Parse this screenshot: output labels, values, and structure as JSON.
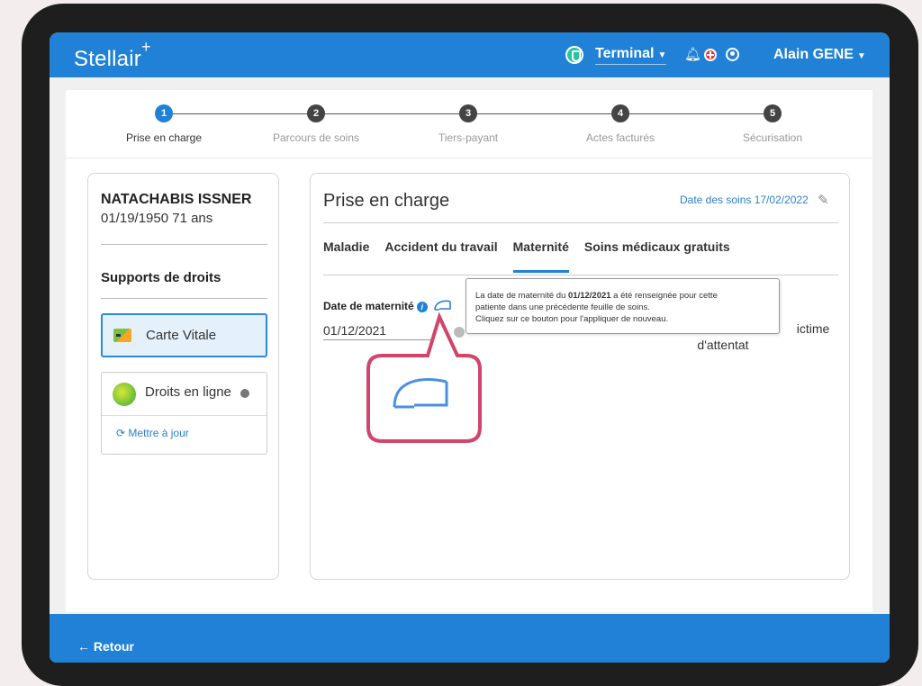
{
  "app": {
    "logo": "Stellair",
    "logo_mark": "+"
  },
  "header": {
    "terminal": "Terminal",
    "user": "Alain GENE"
  },
  "steps": [
    {
      "n": "1",
      "label": "Prise en charge"
    },
    {
      "n": "2",
      "label": "Parcours de soins"
    },
    {
      "n": "3",
      "label": "Tiers-payant"
    },
    {
      "n": "4",
      "label": "Actes facturés"
    },
    {
      "n": "5",
      "label": "Sécurisation"
    }
  ],
  "patient": {
    "name": "NATACHABIS ISSNER",
    "dob": "01/19/1950 71 ans"
  },
  "supports": {
    "title": "Supports de droits",
    "vitale": "Carte Vitale",
    "droits": "Droits en ligne",
    "adri_logo": "ADRi",
    "refresh": "Mettre à jour"
  },
  "main": {
    "title": "Prise en charge",
    "date_soins": "Date des soins 17/02/2022",
    "tabs": [
      "Maladie",
      "Accident du travail",
      "Maternité",
      "Soins médicaux gratuits"
    ],
    "date_maternite_label": "Date de maternité",
    "date_maternite_value": "01/12/2021",
    "victime_line1": "ictime",
    "victime_line2": "d'attentat"
  },
  "tooltip": {
    "pre": "La date de maternité du ",
    "bold": "01/12/2021",
    "post": " a été renseignée pour cette",
    "line2": "patiente dans une précédente feuille de soins.",
    "line3": "Cliquez sur ce bouton pour l'appliquer de nouveau."
  },
  "footer": {
    "retour": "← Retour"
  },
  "colors": {
    "brand": "#2081d6",
    "highlight": "#d1456b"
  }
}
